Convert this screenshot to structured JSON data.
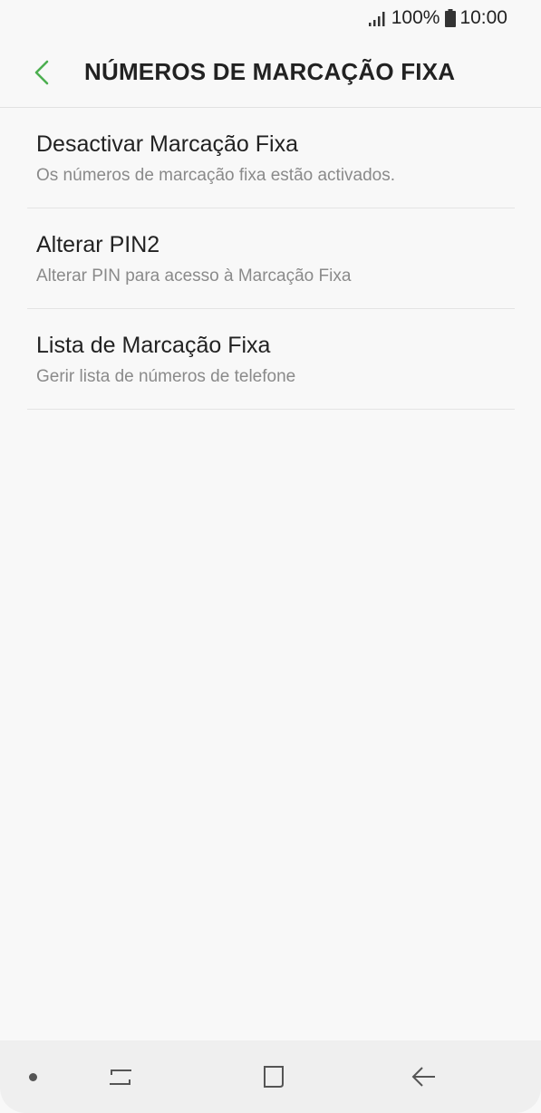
{
  "status_bar": {
    "battery": "100%",
    "time": "10:00"
  },
  "header": {
    "title": "NÚMEROS DE MARCAÇÃO FIXA"
  },
  "items": [
    {
      "title": "Desactivar Marcação Fixa",
      "subtitle": "Os números de marcação fixa estão activados."
    },
    {
      "title": "Alterar PIN2",
      "subtitle": "Alterar PIN para acesso à Marcação Fixa"
    },
    {
      "title": "Lista de Marcação Fixa",
      "subtitle": "Gerir lista de números de telefone"
    }
  ],
  "colors": {
    "accent": "#4caf50",
    "background": "#f8f8f8",
    "text": "#222222",
    "subtext": "#8a8a8a"
  },
  "icons": {
    "back": "chevron-left-icon",
    "signal": "signal-icon",
    "battery": "battery-icon",
    "recents": "recents-icon",
    "home": "home-icon",
    "nav_back": "back-arrow-icon"
  }
}
